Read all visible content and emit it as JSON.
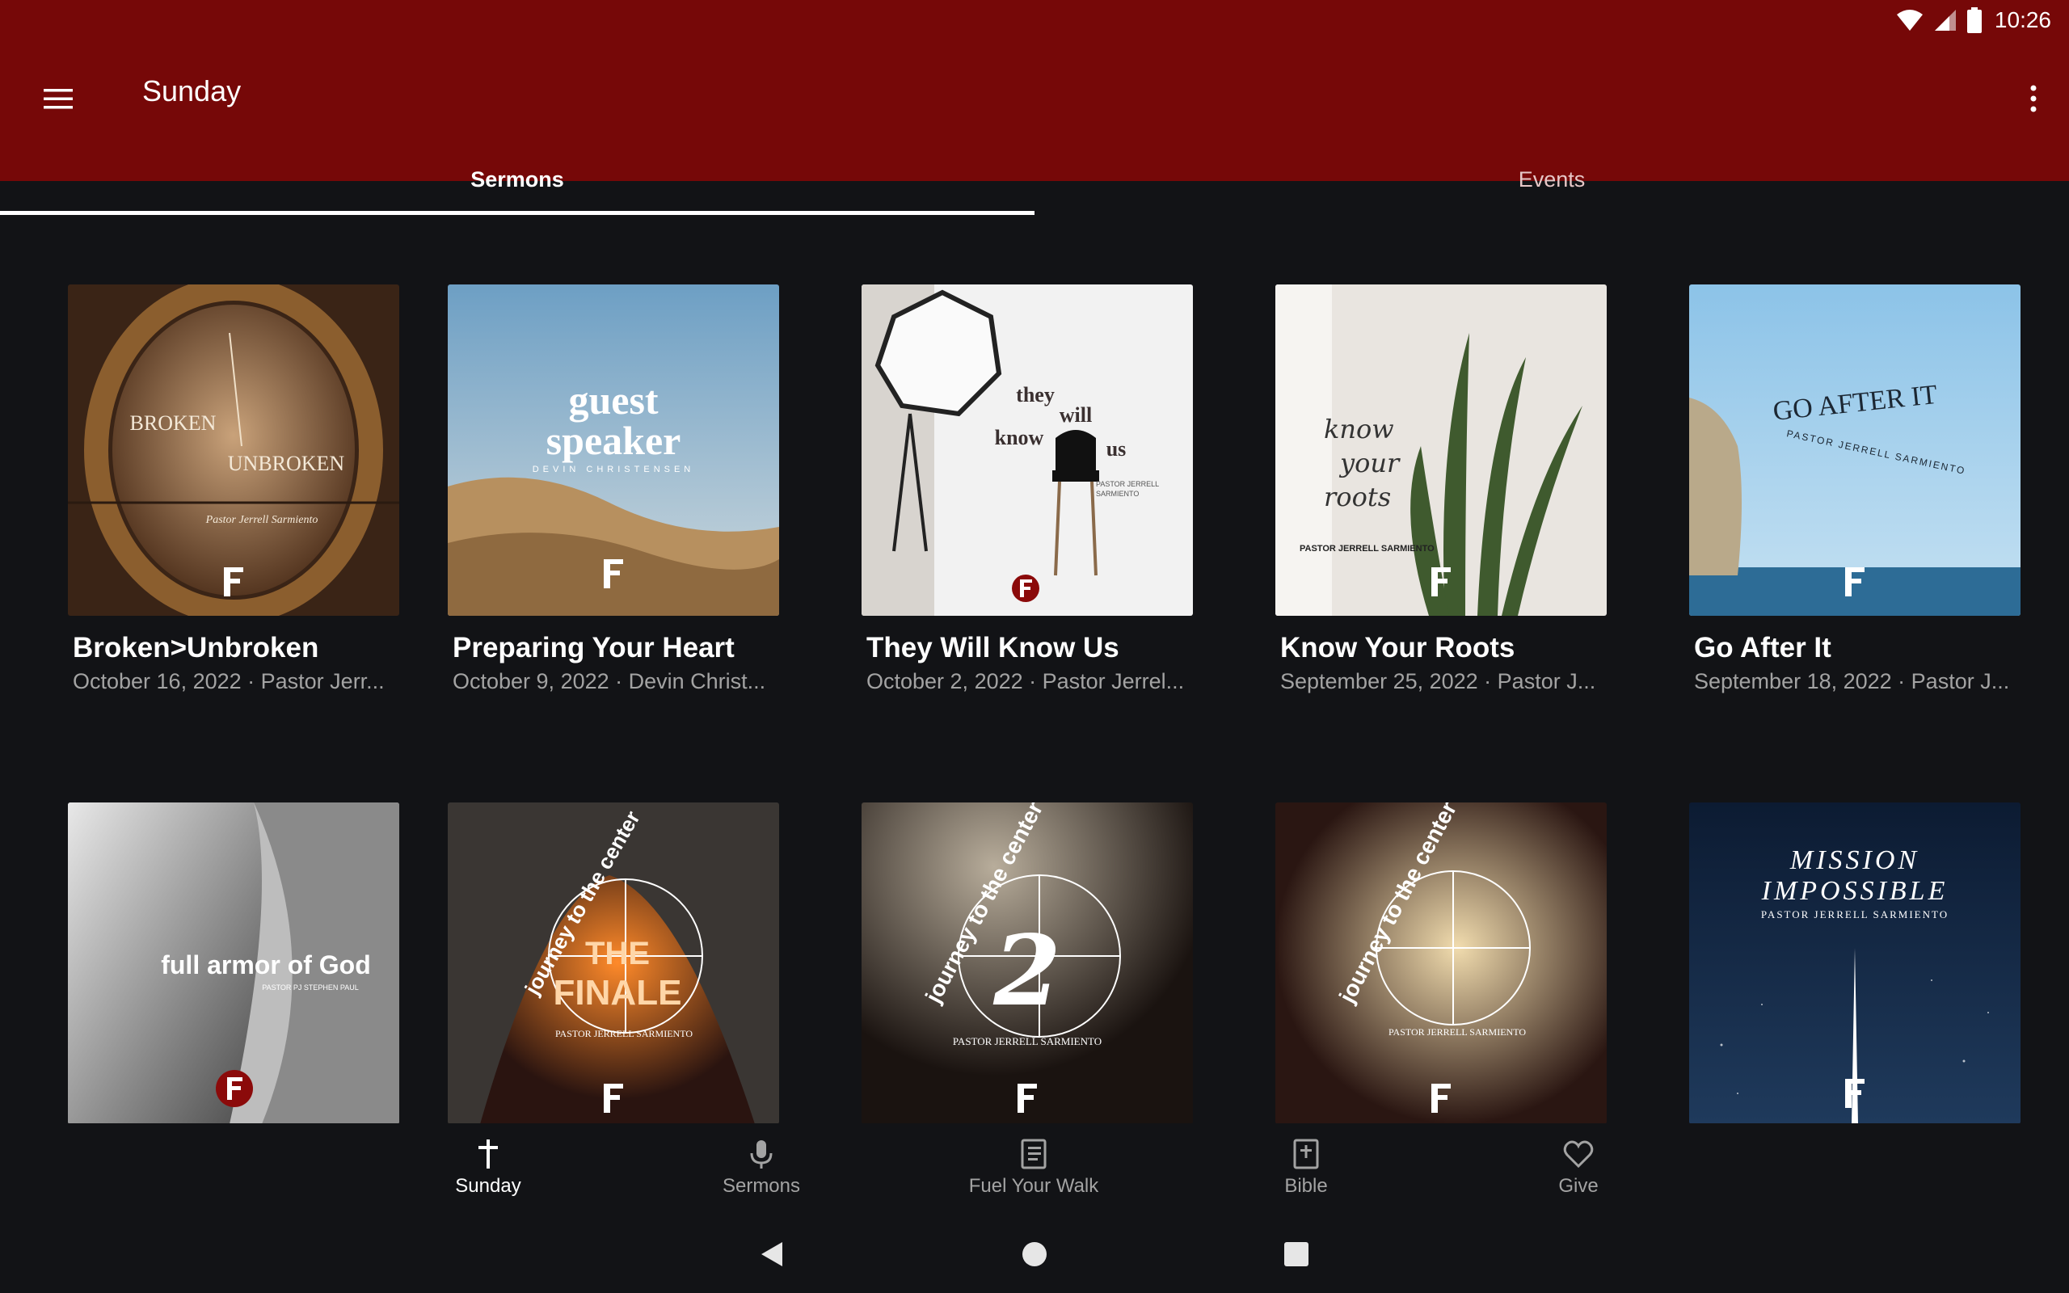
{
  "status_bar": {
    "time": "10:26",
    "icons": [
      "wifi-icon",
      "cell-signal-icon",
      "battery-icon"
    ]
  },
  "app_bar": {
    "title": "Sunday",
    "menu_icon": "menu-icon",
    "more_icon": "more-vert-icon",
    "background": "#760808"
  },
  "tabs": [
    {
      "label": "Sermons",
      "selected": true
    },
    {
      "label": "Events",
      "selected": false
    }
  ],
  "sermons": [
    {
      "title": "Broken>Unbroken",
      "subtitle": "October 16, 2022 · Pastor Jerr...",
      "art_text": [
        "BROKEN",
        "UNBROKEN",
        "Pastor Jerrell Sarmiento"
      ]
    },
    {
      "title": "Preparing Your Heart",
      "subtitle": "October 9, 2022 · Devin Christ...",
      "art_text": [
        "guest",
        "speaker",
        "DEVIN CHRISTENSEN"
      ]
    },
    {
      "title": "They Will Know Us",
      "subtitle": "October 2, 2022 · Pastor Jerrel...",
      "art_text": [
        "they",
        "will",
        "know",
        "us",
        "PASTOR JERRELL",
        "SARMIENTO"
      ]
    },
    {
      "title": "Know Your Roots",
      "subtitle": "September 25, 2022 · Pastor J...",
      "art_text": [
        "know",
        "your",
        "roots",
        "PASTOR JERRELL SARMIENTO"
      ]
    },
    {
      "title": "Go After It",
      "subtitle": "September 18, 2022 · Pastor J...",
      "art_text": [
        "GO AFTER IT",
        "PASTOR JERRELL SARMIENTO"
      ]
    },
    {
      "title": "",
      "subtitle": "",
      "art_text": [
        "full armor of God",
        "PASTOR PJ STEPHEN PAUL"
      ]
    },
    {
      "title": "",
      "subtitle": "",
      "art_text": [
        "journey to the center",
        "THE",
        "FINALE",
        "PASTOR JERRELL SARMIENTO"
      ]
    },
    {
      "title": "",
      "subtitle": "",
      "art_text": [
        "journey to the center",
        "2",
        "PASTOR JERRELL SARMIENTO"
      ]
    },
    {
      "title": "",
      "subtitle": "",
      "art_text": [
        "journey to the center",
        "PASTOR JERRELL SARMIENTO"
      ]
    },
    {
      "title": "",
      "subtitle": "",
      "art_text": [
        "MISSION",
        "IMPOSSIBLE",
        "PASTOR JERRELL SARMIENTO"
      ]
    }
  ],
  "bottom_nav": [
    {
      "label": "Sunday",
      "icon": "cross-icon",
      "active": true
    },
    {
      "label": "Sermons",
      "icon": "microphone-icon",
      "active": false
    },
    {
      "label": "Fuel Your Walk",
      "icon": "book-icon",
      "active": false
    },
    {
      "label": "Bible",
      "icon": "bible-icon",
      "active": false
    },
    {
      "label": "Give",
      "icon": "heart-icon",
      "active": false
    }
  ],
  "system_nav": {
    "icons": [
      "back-icon",
      "home-icon",
      "recents-icon"
    ]
  }
}
